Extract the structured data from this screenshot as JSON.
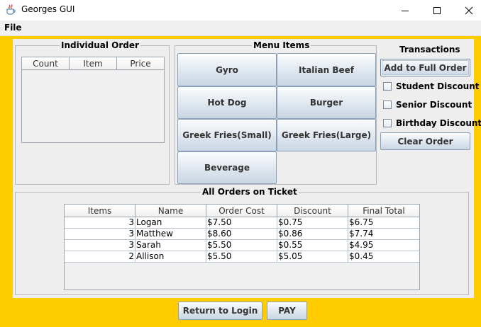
{
  "window": {
    "title": "Georges GUI"
  },
  "menu": {
    "file_label": "File"
  },
  "individual_order": {
    "title": "Individual Order",
    "columns": [
      "Count",
      "Item",
      "Price"
    ]
  },
  "menu_items": {
    "title": "Menu Items",
    "buttons": [
      "Gyro",
      "Italian Beef",
      "Hot Dog",
      "Burger",
      "Greek Fries(Small)",
      "Greek Fries(Large)",
      "Beverage"
    ]
  },
  "transactions": {
    "title": "Transactions",
    "add_label": "Add to Full Order",
    "student_label": "Student Discount",
    "senior_label": "Senior Discount",
    "birthday_label": "Birthday Discount",
    "clear_label": "Clear Order"
  },
  "all_orders": {
    "title": "All Orders on Ticket",
    "columns": [
      "Items",
      "Name",
      "Order Cost",
      "Discount",
      "Final Total"
    ],
    "rows": [
      [
        "3",
        "Logan",
        "$7.50",
        "$0.75",
        "$6.75"
      ],
      [
        "3",
        "Matthew",
        "$8.60",
        "$0.86",
        "$7.74"
      ],
      [
        "3",
        "Sarah",
        "$5.50",
        "$0.55",
        "$4.95"
      ],
      [
        "2",
        "Allison",
        "$5.50",
        "$5.05",
        "$0.45"
      ]
    ]
  },
  "bottom": {
    "return_label": "Return to Login",
    "pay_label": "PAY"
  },
  "colors": {
    "frame": "#ffcc00",
    "panel": "#eeeeee"
  },
  "icons": {
    "app": "java-cup-icon",
    "minimize": "minimize-icon",
    "maximize": "maximize-icon",
    "close": "close-icon"
  }
}
